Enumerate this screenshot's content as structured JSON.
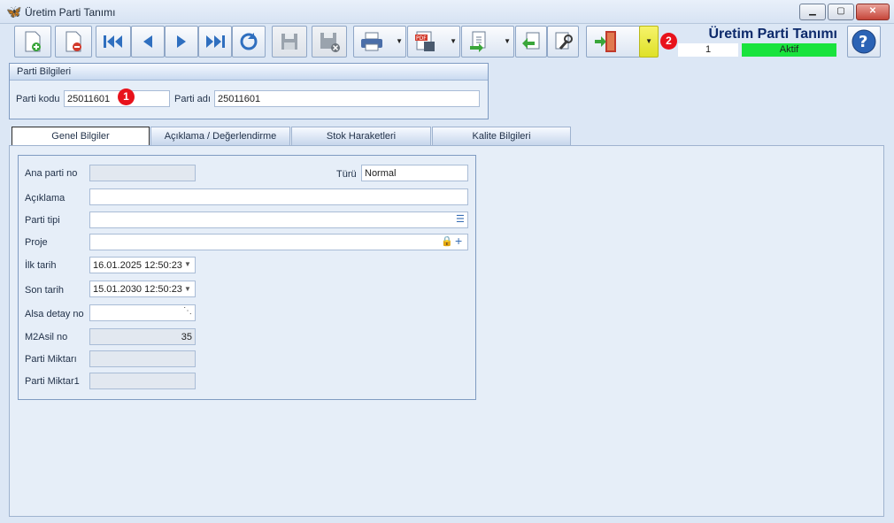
{
  "window": {
    "title": "Üretim Parti Tanımı"
  },
  "header": {
    "title": "Üretim Parti Tanımı",
    "record_no": "1",
    "status": "Aktif",
    "status_color": "#19e33d"
  },
  "annotations": {
    "badge1": "1",
    "badge2": "2"
  },
  "toolbar": {
    "icons": [
      "new-icon",
      "delete-icon",
      "first-icon",
      "previous-icon",
      "next-icon",
      "last-icon",
      "refresh-icon",
      "save-icon",
      "cancel-save-icon",
      "print-icon",
      "pdf-export-icon",
      "export-icon",
      "back-icon",
      "settings-icon",
      "exit-door-icon",
      "help-icon"
    ]
  },
  "group": {
    "title": "Parti Bilgileri",
    "code_label": "Parti kodu",
    "code_value": "25011601",
    "name_label": "Parti adı",
    "name_value": "25011601"
  },
  "tabs": [
    "Genel Bilgiler",
    "Açıklama / Değerlendirme",
    "Stok Haraketleri",
    "Kalite Bilgileri"
  ],
  "form": {
    "ana_parti_no": {
      "label": "Ana parti no",
      "value": ""
    },
    "turu": {
      "label": "Türü",
      "value": "Normal"
    },
    "aciklama": {
      "label": "Açıklama",
      "value": ""
    },
    "parti_tipi": {
      "label": "Parti tipi",
      "value": ""
    },
    "proje": {
      "label": "Proje",
      "value": ""
    },
    "ilk_tarih": {
      "label": "İlk tarih",
      "value": "16.01.2025 12:50:23"
    },
    "son_tarih": {
      "label": "Son tarih",
      "value": "15.01.2030 12:50:23"
    },
    "alsa_detay_no": {
      "label": "Alsa detay no",
      "value": ""
    },
    "m2asil_no": {
      "label": "M2Asil no",
      "value": "35"
    },
    "parti_miktari": {
      "label": "Parti Miktarı",
      "value": ""
    },
    "parti_miktar1": {
      "label": "Parti Miktar1",
      "value": ""
    }
  }
}
